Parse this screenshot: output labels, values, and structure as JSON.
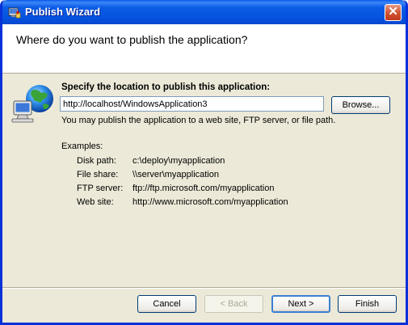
{
  "window": {
    "title": "Publish Wizard",
    "close_glyph": "✕"
  },
  "header": {
    "title": "Where do you want to publish the application?"
  },
  "location": {
    "label": "Specify the location to publish this application:",
    "value": "http://localhost/WindowsApplication3",
    "browse_label": "Browse...",
    "help": "You may publish the application to a web site, FTP server, or file path."
  },
  "examples": {
    "heading": "Examples:",
    "rows": [
      {
        "label": "Disk path:",
        "value": "c:\\deploy\\myapplication"
      },
      {
        "label": "File share:",
        "value": "\\\\server\\myapplication"
      },
      {
        "label": "FTP server:",
        "value": "ftp://ftp.microsoft.com/myapplication"
      },
      {
        "label": "Web site:",
        "value": "http://www.microsoft.com/myapplication"
      }
    ]
  },
  "buttons": {
    "cancel": "Cancel",
    "back": "< Back",
    "next": "Next >",
    "finish": "Finish"
  },
  "icons": {
    "title_icon": "publish-wizard-icon",
    "globe_icon": "globe-computer-icon"
  },
  "colors": {
    "titlebar": "#0554e0",
    "dialog_bg": "#ece9d8",
    "close_button": "#d0502d"
  }
}
